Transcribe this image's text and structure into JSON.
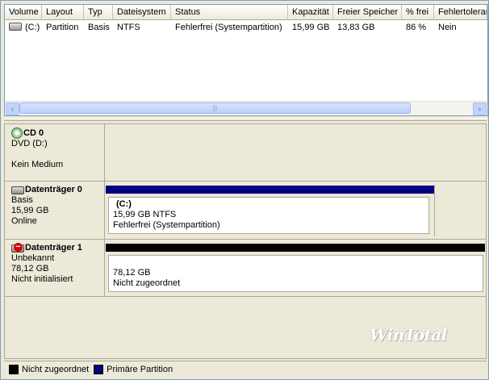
{
  "volumes": {
    "columns": [
      "Volume",
      "Layout",
      "Typ",
      "Dateisystem",
      "Status",
      "Kapazität",
      "Freier Speicher",
      "% frei",
      "Fehlertoleranz"
    ],
    "rows": [
      [
        "(C:)",
        "Partition",
        "Basis",
        "NTFS",
        "Fehlerfrei (Systempartition)",
        "15,99 GB",
        "13,83 GB",
        "86 %",
        "Nein"
      ]
    ],
    "row_icon": "drive-icon",
    "scroll_left_icon": "‹",
    "scroll_right_icon": "›",
    "scroll_grip": "|||"
  },
  "disks": [
    {
      "icon": "cd-icon",
      "title": "CD 0",
      "line1": "DVD (D:)",
      "line2": "",
      "line3": "Kein Medium"
    },
    {
      "icon": "hard-disk-icon",
      "title": "Datenträger 0",
      "line1": "Basis",
      "line2": "15,99 GB",
      "line3": "Online",
      "partition": {
        "name": "(C:)",
        "size": "15,99 GB NTFS",
        "status": "Fehlerfrei (Systempartition)",
        "bar_color": "#000080"
      }
    },
    {
      "icon": "unknown-disk-icon",
      "title": "Datenträger 1",
      "line1": "Unbekannt",
      "line2": "78,12 GB",
      "line3": "Nicht initialisiert",
      "partition": {
        "name": "",
        "size": "78,12 GB",
        "status": "Nicht zugeordnet",
        "bar_color": "#000000"
      }
    }
  ],
  "legend": [
    {
      "label": "Nicht zugeordnet",
      "color": "#000000"
    },
    {
      "label": "Primäre Partition",
      "color": "#000080"
    }
  ],
  "watermark": "WinTotal"
}
